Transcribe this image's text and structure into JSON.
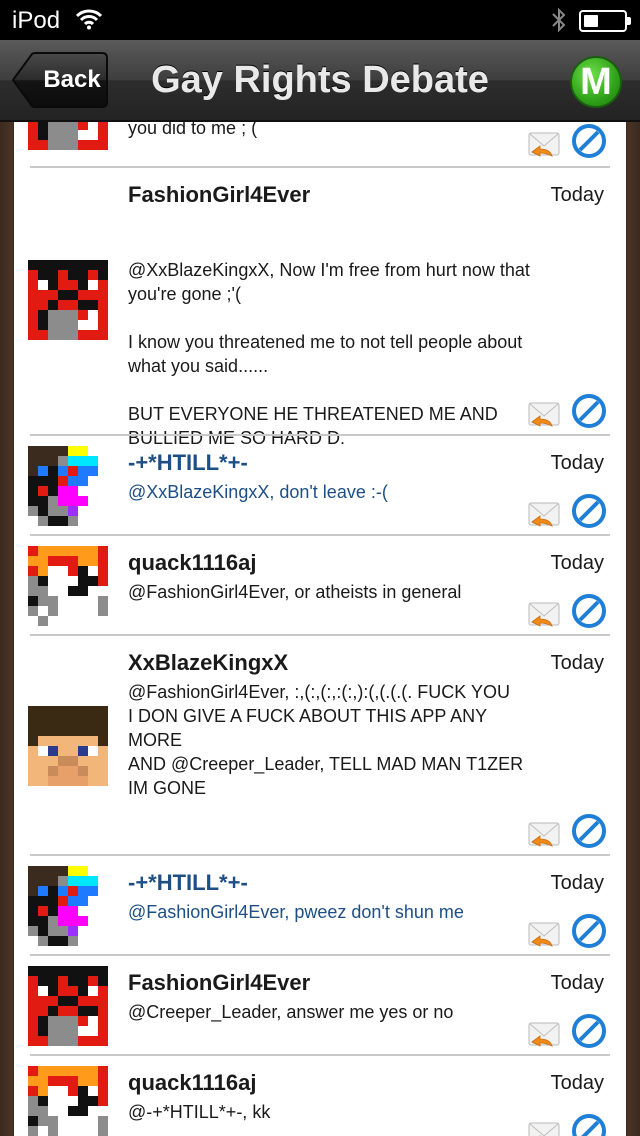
{
  "status": {
    "carrier": "iPod",
    "battery_level": 0.35
  },
  "nav": {
    "back_label": "Back",
    "title": "Gay Rights Debate",
    "menu_label": "M"
  },
  "top_partial": {
    "text": "you did to me ; ("
  },
  "posts": [
    {
      "user": "FashionGirl4Ever",
      "time": "Today",
      "text": "@XxBlazeKingxX, Now I'm free from hurt now that you're gone ;'(\n\nI know you threatened me to not tell people about what you said......\n\nBUT EVERYONE HE THREATENED ME AND BULLIED ME SO HARD D:",
      "avatar": "red"
    },
    {
      "user": "-+*HTILL*+-",
      "time": "Today",
      "text": "@XxBlazeKingxX, don't leave :-(",
      "avatar": "rainbow"
    },
    {
      "user": "quack1116aj",
      "time": "Today",
      "text": "@FashionGirl4Ever, or atheists in general",
      "avatar": "orange"
    },
    {
      "user": "XxBlazeKingxX",
      "time": "Today",
      "text": "@FashionGirl4Ever, :,(:,(:,:(:,):(,(.(.(. FUCK YOU\nI DON GIVE A FUCK ABOUT THIS APP ANY MORE\nAND @Creeper_Leader, TELL MAD MAN T1ZER IM GONE",
      "avatar": "steve"
    },
    {
      "user": "-+*HTILL*+-",
      "time": "Today",
      "text": "@FashionGirl4Ever, pweez don't shun me",
      "avatar": "rainbow"
    },
    {
      "user": "FashionGirl4Ever",
      "time": "Today",
      "text": "@Creeper_Leader, answer me yes or no",
      "avatar": "red"
    },
    {
      "user": "quack1116aj",
      "time": "Today",
      "text": "@-+*HTILL*+-, kk",
      "avatar": "orange"
    }
  ],
  "icons": {
    "reply": "reply-envelope-icon",
    "block": "block-icon"
  },
  "colors": {
    "blue_user": "#1d4f86",
    "accent_green": "#2fa219",
    "action_blue": "#1f7fd6",
    "reply_orange": "#f08a1a"
  }
}
